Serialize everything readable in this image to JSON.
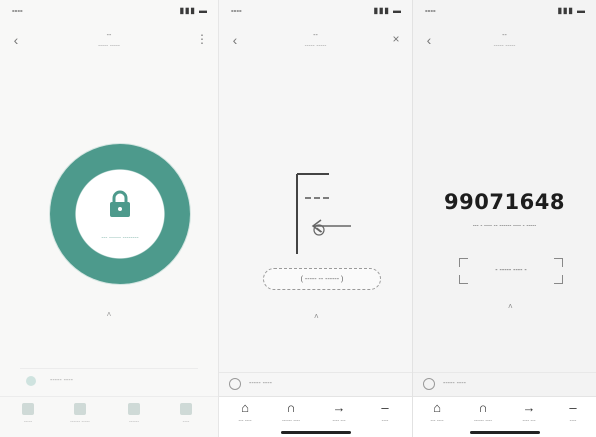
{
  "screen1": {
    "status": {
      "time": "----",
      "signal": "▮▮▮ ▬"
    },
    "nav": {
      "back": "‹",
      "title": "--",
      "subtitle": "----- -----",
      "more": "⋮"
    },
    "lock_label": "--- ------ --------",
    "arrow": "˄",
    "favorite": "----- ----",
    "tabs": [
      {
        "label": "-----"
      },
      {
        "label": "------ -----"
      },
      {
        "label": "------"
      },
      {
        "label": "----"
      }
    ]
  },
  "screen2": {
    "status": {
      "time": "----",
      "signal": "▮▮▮ ▬"
    },
    "nav": {
      "back": "‹",
      "title": "--",
      "subtitle": "----- -----",
      "close": "×"
    },
    "slide_button": "( ----- -- ------ )",
    "dot": "˄",
    "favorite": "----- ----",
    "tabs": [
      {
        "glyph": "⌂",
        "label": "--- ----"
      },
      {
        "glyph": "∩",
        "label": "------ ----"
      },
      {
        "glyph": "→",
        "label": "---- ---"
      },
      {
        "glyph": "–",
        "label": "----"
      }
    ]
  },
  "screen3": {
    "status": {
      "time": "----",
      "signal": "▮▮▮ ▬"
    },
    "nav": {
      "back": "‹",
      "title": "--",
      "subtitle": "----- -----"
    },
    "code": "99071648",
    "code_description": "--- - ---- -- ------ ---- - -----",
    "action_button": "- ----- ---- -",
    "dot": "˄",
    "favorite": "----- ----",
    "tabs": [
      {
        "glyph": "⌂",
        "label": "--- ----"
      },
      {
        "glyph": "∩",
        "label": "------ ----"
      },
      {
        "glyph": "→",
        "label": "---- ---"
      },
      {
        "glyph": "–",
        "label": "----"
      }
    ]
  },
  "colors": {
    "accent": "#4d9a8c",
    "accent_light": "#7fb4a9"
  }
}
